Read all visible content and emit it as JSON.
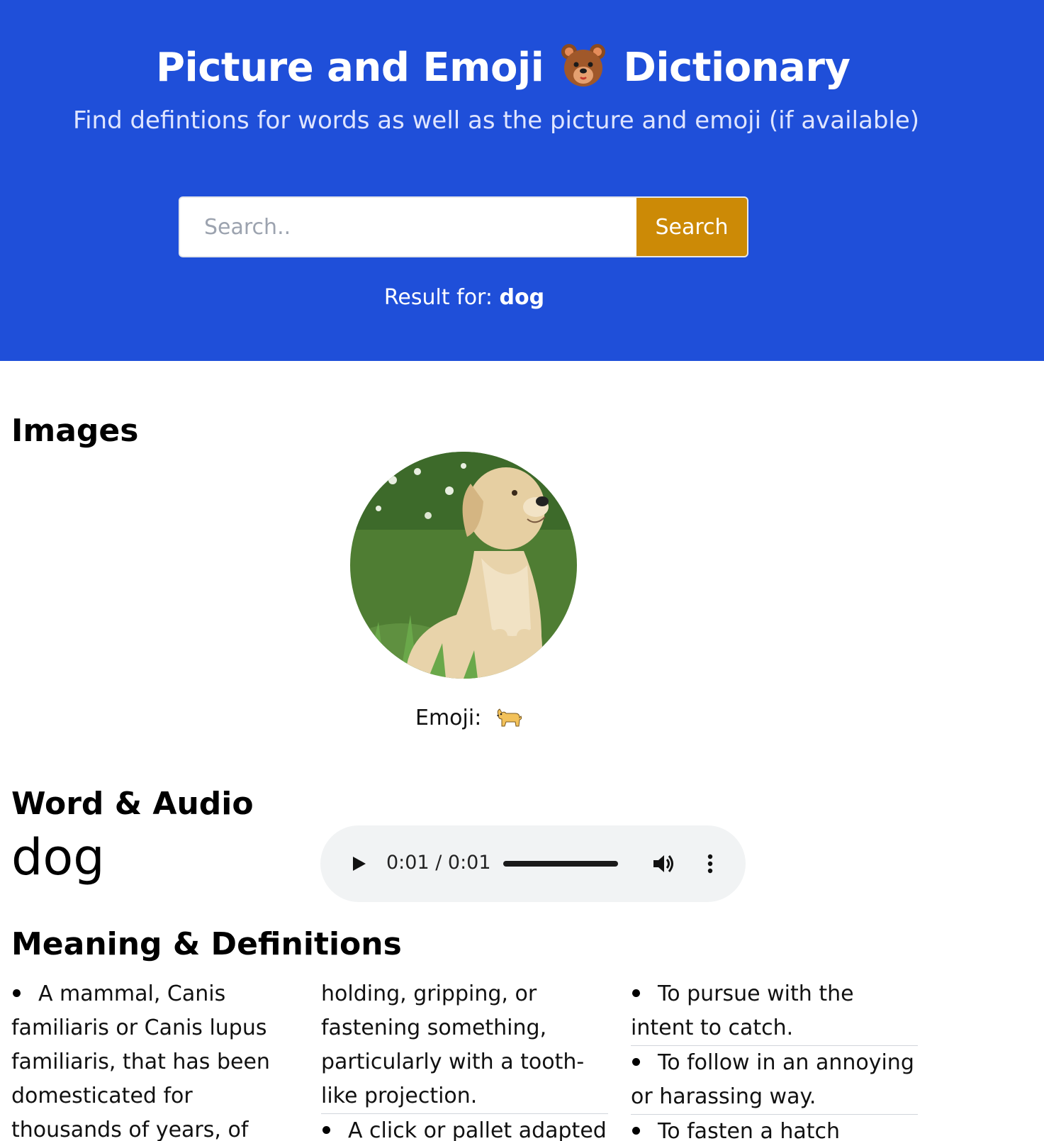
{
  "header": {
    "title_part1": "Picture and Emoji",
    "title_part2": "Dictionary",
    "title_icon": "bear-face-icon",
    "subtitle": "Find defintions for words as well as the picture and emoji (if available)",
    "search": {
      "placeholder": "Search..",
      "value": "",
      "button_label": "Search"
    },
    "result_label": "Result for:",
    "result_word": "dog"
  },
  "images": {
    "heading": "Images",
    "photo_icon": "dog-photo",
    "emoji_label": "Emoji:",
    "emoji_icon": "dog-emoji"
  },
  "word_audio": {
    "heading": "Word & Audio",
    "word": "dog",
    "audio": {
      "time": "0:01 / 0:01",
      "progress": 1.0
    }
  },
  "definitions": {
    "heading": "Meaning & Definitions",
    "col1": [
      {
        "text": "A mammal, Canis familiaris or Canis lupus familiaris, that has been domesticated for thousands of years, of highly variable"
      }
    ],
    "col2": [
      {
        "text": "holding, gripping, or fastening something, particularly with a tooth-like projection.",
        "continued": true
      },
      {
        "text": "A click or pallet adapted"
      }
    ],
    "col3": [
      {
        "text": "To pursue with the intent to catch."
      },
      {
        "text": "To follow in an annoying or harassing way."
      },
      {
        "text": "To fasten a hatch"
      }
    ]
  },
  "colors": {
    "header_bg": "#1f4fd9",
    "search_button": "#cc8a06",
    "audio_bg": "#f1f3f4"
  }
}
